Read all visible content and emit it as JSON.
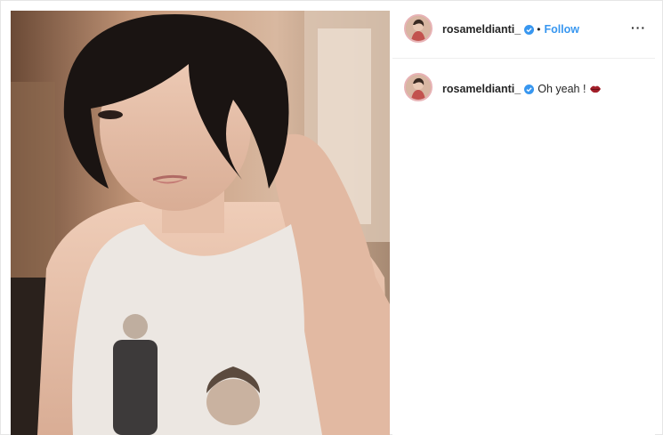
{
  "post": {
    "username": "rosameldianti_",
    "verified": true,
    "follow_label": "Follow",
    "separator": "•",
    "more_label": "···"
  },
  "caption": {
    "username": "rosameldianti_",
    "text": "Oh yeah !",
    "emoji_icon": "lips-icon"
  },
  "colors": {
    "follow": "#3897f0",
    "verified": "#3897f0",
    "avatar_ring": "#e8b3b6"
  }
}
